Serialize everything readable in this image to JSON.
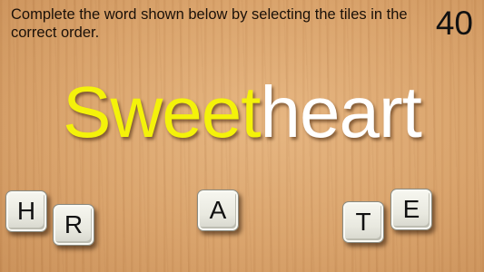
{
  "game": {
    "instructions": "Complete the word shown below by selecting the tiles in the correct order.",
    "timer": "40",
    "word": {
      "completed": "Sweet",
      "remaining": "heart"
    },
    "tiles": [
      {
        "letter": "H"
      },
      {
        "letter": "R"
      },
      {
        "letter": "A"
      },
      {
        "letter": "T"
      },
      {
        "letter": "E"
      }
    ],
    "colors": {
      "completed_letters": "#f4f20a",
      "remaining_letters": "#ffffff",
      "board": "#d9a46c"
    }
  }
}
